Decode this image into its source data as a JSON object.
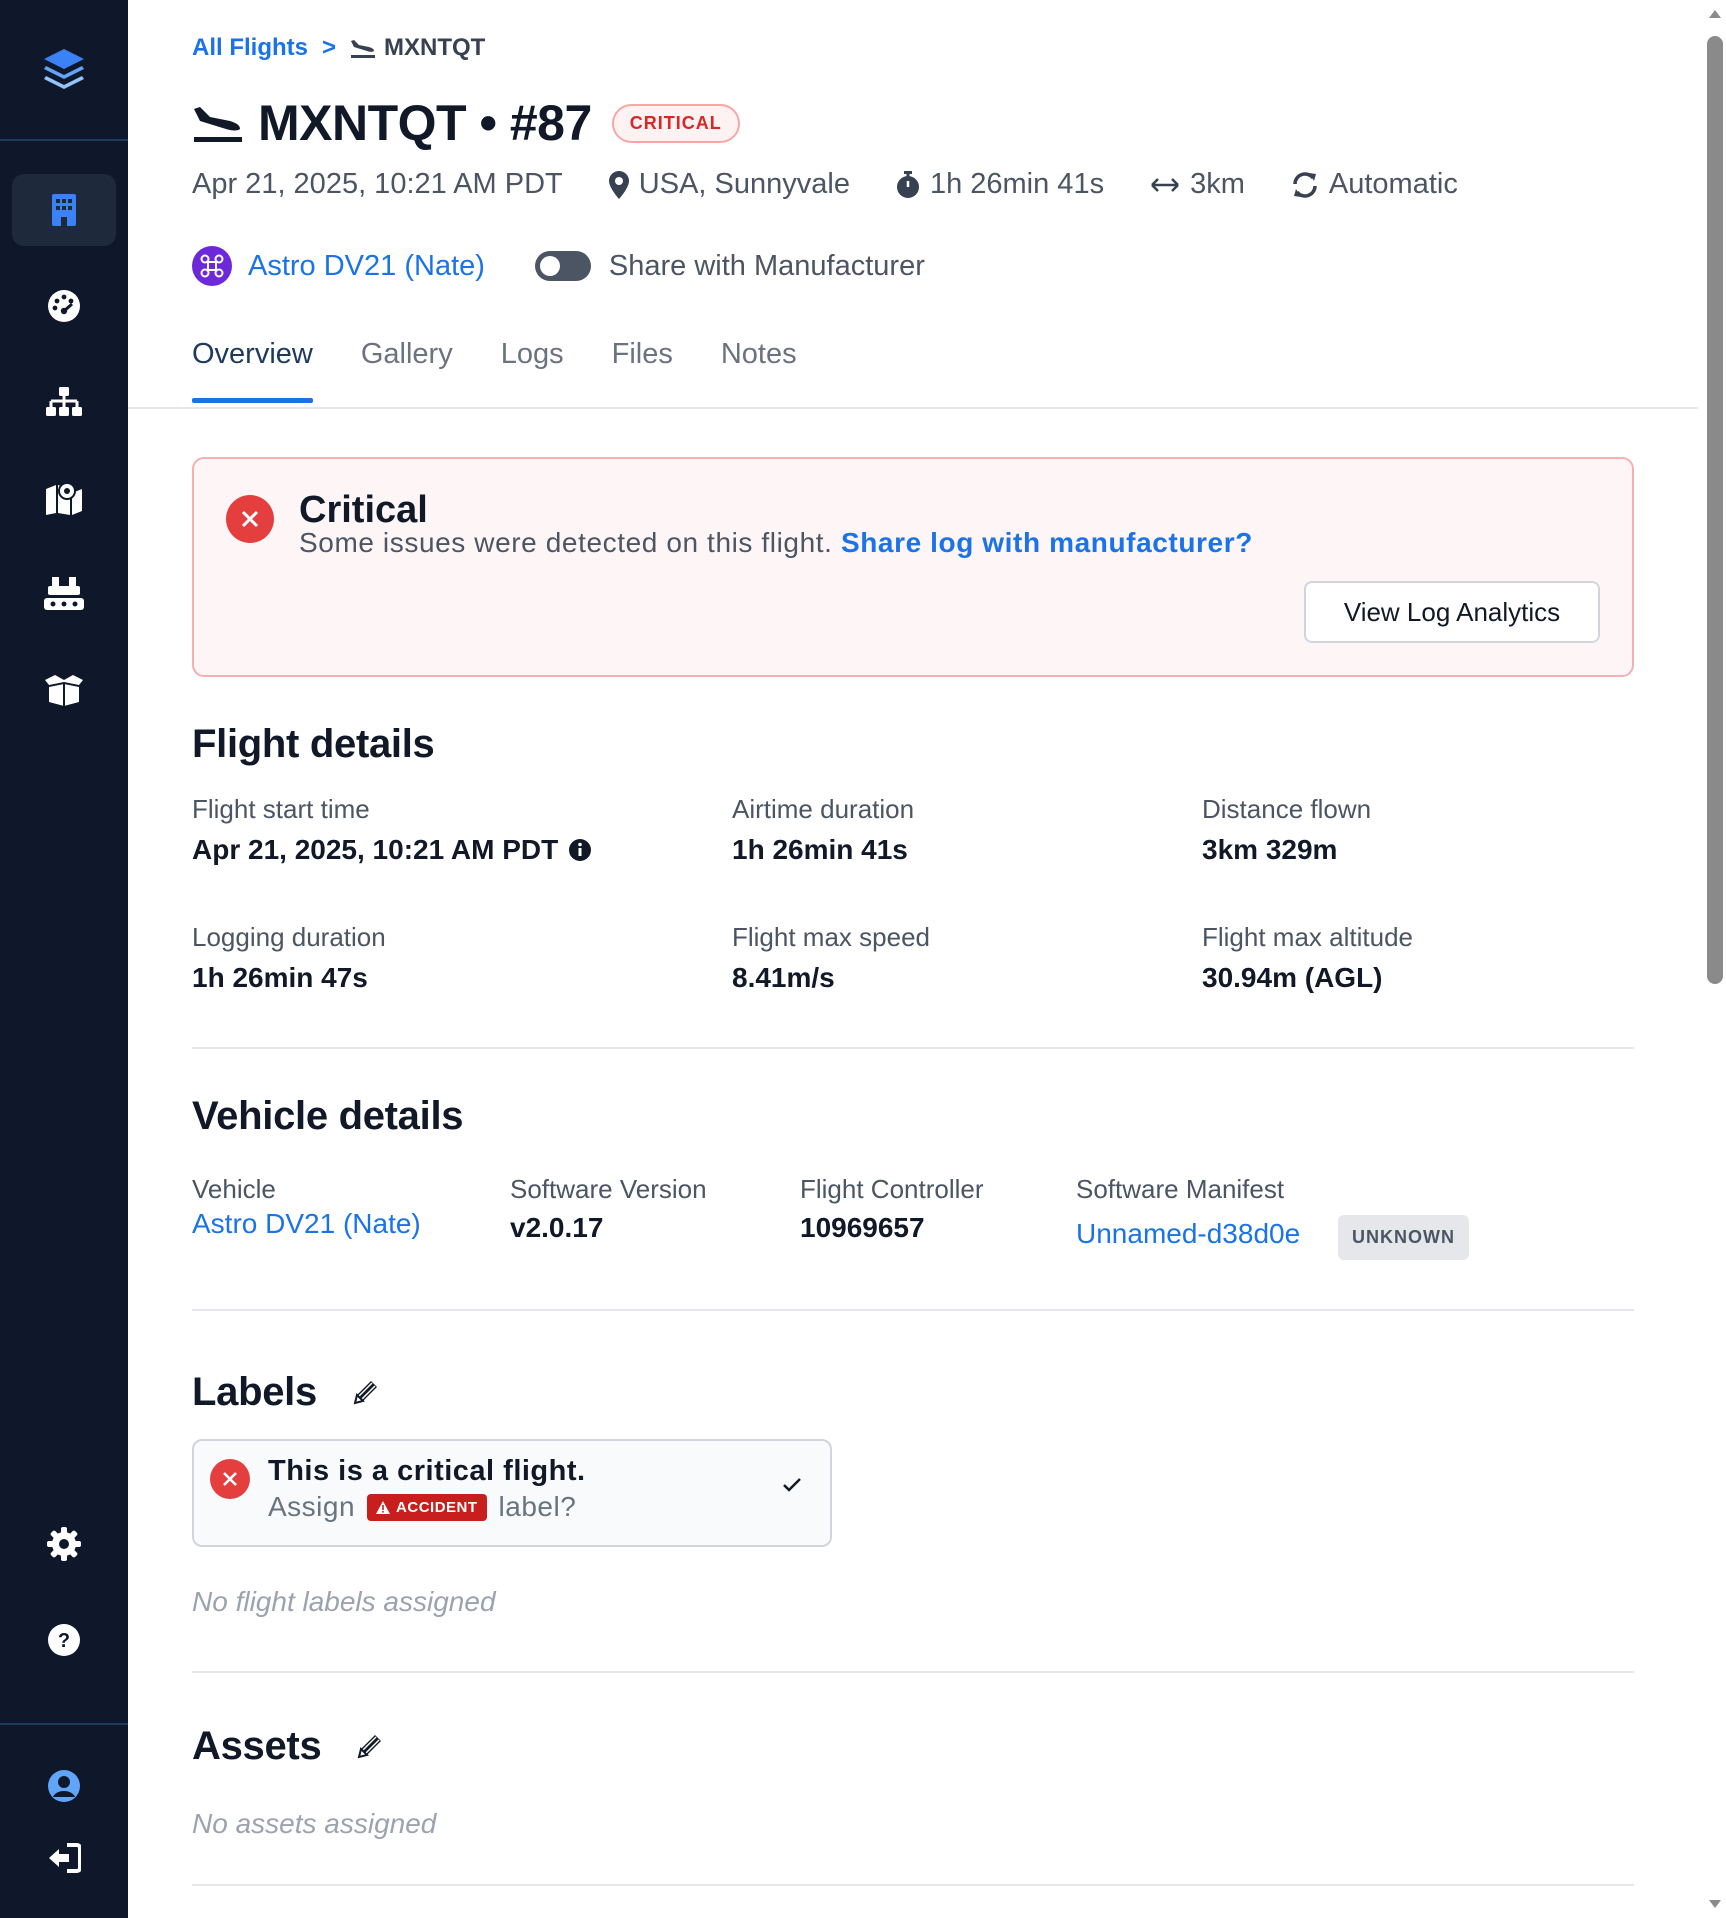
{
  "breadcrumb": {
    "root": "All Flights",
    "separator": ">",
    "current": "MXNTQT"
  },
  "header": {
    "title": "MXNTQT • #87",
    "status_badge": "CRITICAL",
    "meta": {
      "date": "Apr 21, 2025, 10:21 AM PDT",
      "location": "USA, Sunnyvale",
      "duration": "1h 26min 41s",
      "distance": "3km",
      "mode": "Automatic"
    },
    "vehicle_link": "Astro DV21 (Nate)",
    "share_toggle_label": "Share with Manufacturer",
    "share_toggle_on": false
  },
  "tabs": [
    {
      "label": "Overview",
      "active": true
    },
    {
      "label": "Gallery",
      "active": false
    },
    {
      "label": "Logs",
      "active": false
    },
    {
      "label": "Files",
      "active": false
    },
    {
      "label": "Notes",
      "active": false
    }
  ],
  "alert": {
    "title": "Critical",
    "text": "Some issues were detected on this flight.",
    "link": "Share log with manufacturer?",
    "button": "View Log Analytics"
  },
  "flight_details": {
    "title": "Flight details",
    "fields": [
      {
        "label": "Flight start time",
        "value": "Apr 21, 2025, 10:21 AM PDT"
      },
      {
        "label": "Airtime duration",
        "value": "1h 26min 41s"
      },
      {
        "label": "Distance flown",
        "value": "3km 329m"
      },
      {
        "label": "Logging duration",
        "value": "1h 26min 47s"
      },
      {
        "label": "Flight max speed",
        "value": "8.41m/s"
      },
      {
        "label": "Flight max altitude",
        "value": "30.94m (AGL)"
      }
    ]
  },
  "vehicle_details": {
    "title": "Vehicle details",
    "vehicle_label": "Vehicle",
    "vehicle_value": "Astro DV21 (Nate)",
    "software_version_label": "Software Version",
    "software_version_value": "v2.0.17",
    "flight_controller_label": "Flight Controller",
    "flight_controller_value": "10969657",
    "software_manifest_label": "Software Manifest",
    "software_manifest_value": "Unnamed-d38d0e",
    "software_manifest_badge": "UNKNOWN"
  },
  "labels": {
    "title": "Labels",
    "suggestion_title": "This is a critical flight.",
    "suggestion_prefix": "Assign",
    "suggestion_badge": "ACCIDENT",
    "suggestion_suffix": "label?",
    "empty": "No flight labels assigned"
  },
  "assets": {
    "title": "Assets",
    "empty": "No assets assigned"
  },
  "colors": {
    "sidebar_bg": "#0f172a",
    "accent": "#1a73e8",
    "critical": "#e53e3e",
    "sidebar_icon": "#ffffff",
    "sidebar_icon_active": "#3b82f6"
  },
  "sidebar": {
    "icons": [
      "layers-logo-icon",
      "building-icon",
      "dashboard-gauge-icon",
      "hierarchy-icon",
      "map-location-icon",
      "fleet-dock-icon",
      "package-box-icon",
      "settings-gear-icon",
      "help-question-icon",
      "user-account-icon",
      "logout-icon"
    ]
  }
}
